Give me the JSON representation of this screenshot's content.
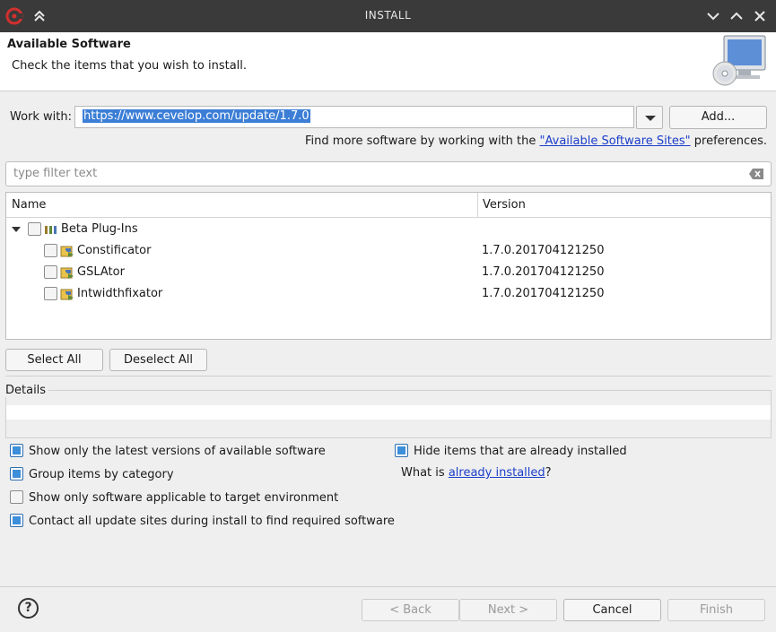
{
  "window": {
    "title": "INSTALL"
  },
  "header": {
    "title": "Available Software",
    "description": "Check the items that you wish to install."
  },
  "work_with": {
    "label": "Work with:",
    "value": "https://www.cevelop.com/update/1.7.0",
    "add_label": "Add...",
    "find_more_prefix": "Find more software by working with the ",
    "sites_link": "\"Available Software Sites\"",
    "find_more_suffix": " preferences."
  },
  "filter": {
    "placeholder": "type filter text"
  },
  "tree": {
    "columns": [
      "Name",
      "Version"
    ],
    "category": {
      "name": "Beta Plug-Ins",
      "checked": false,
      "expanded": true
    },
    "items": [
      {
        "name": "Constificator",
        "version": "1.7.0.201704121250",
        "checked": false
      },
      {
        "name": "GSLAtor",
        "version": "1.7.0.201704121250",
        "checked": false
      },
      {
        "name": "Intwidthfixator",
        "version": "1.7.0.201704121250",
        "checked": false
      }
    ]
  },
  "selection": {
    "select_all": "Select All",
    "deselect_all": "Deselect All"
  },
  "details": {
    "label": "Details"
  },
  "options": {
    "latest_only": {
      "label": "Show only the latest versions of available software",
      "checked": true
    },
    "group_by_category": {
      "label": "Group items by category",
      "checked": true
    },
    "target_env": {
      "label": "Show only software applicable to target environment",
      "checked": false
    },
    "contact_sites": {
      "label": "Contact all update sites during install to find required software",
      "checked": true
    },
    "hide_installed": {
      "label": "Hide items that are already installed",
      "checked": true
    },
    "what_is_prefix": "What is ",
    "what_is_link": "already installed",
    "what_is_suffix": "?"
  },
  "footer": {
    "back": "< Back",
    "next": "Next >",
    "cancel": "Cancel",
    "finish": "Finish"
  },
  "colors": {
    "accent": "#3c8fd8",
    "link": "#1b3ec9",
    "titlebar": "#3a3a3a"
  }
}
